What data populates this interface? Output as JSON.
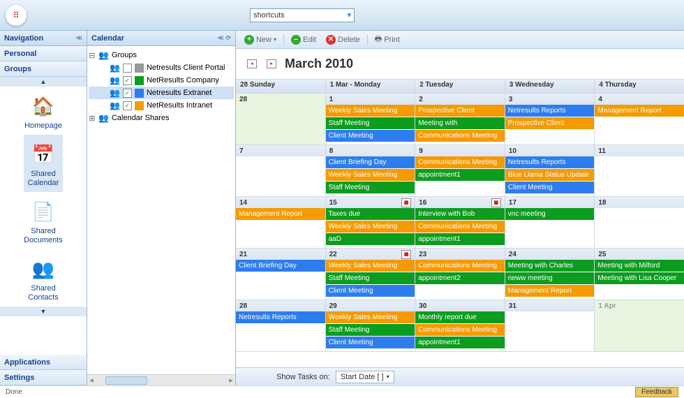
{
  "top": {
    "shortcuts": "shortcuts"
  },
  "nav": {
    "title": "Navigation",
    "personal": "Personal",
    "groups": "Groups",
    "applications": "Applications",
    "settings": "Settings",
    "items": [
      {
        "label": "Homepage"
      },
      {
        "label": "Shared Calendar"
      },
      {
        "label": "Shared Documents"
      },
      {
        "label": "Shared Contacts"
      }
    ]
  },
  "cal": {
    "title": "Calendar",
    "tree": {
      "root": "Groups",
      "shares": "Calendar Shares",
      "items": [
        {
          "label": "Netresults Client Portal",
          "checked": false,
          "color": "#999999"
        },
        {
          "label": "NetResults Company",
          "checked": true,
          "color": "#0c9d1f"
        },
        {
          "label": "Netresults Extranet",
          "checked": true,
          "color": "#2d7def"
        },
        {
          "label": "NetResults Intranet",
          "checked": true,
          "color": "#f59a00"
        }
      ]
    }
  },
  "toolbar": {
    "new": "New",
    "edit": "Edit",
    "delete": "Delete",
    "print": "Print"
  },
  "month": {
    "title": "March 2010"
  },
  "headers": [
    "28 Sunday",
    "1 Mar - Monday",
    "2 Tuesday",
    "3 Wednesday",
    "4 Thursday"
  ],
  "weeks": [
    {
      "days": [
        {
          "num": "28",
          "pale": true,
          "events": []
        },
        {
          "num": "1",
          "events": [
            {
              "t": "Weekly Sales Meeting",
              "c": "orange"
            },
            {
              "t": "Staff Meeting",
              "c": "green"
            },
            {
              "t": "Client Meeting",
              "c": "blue"
            }
          ]
        },
        {
          "num": "2",
          "events": [
            {
              "t": "Prospective Client",
              "c": "orange"
            },
            {
              "t": "Meeting with",
              "c": "green"
            },
            {
              "t": "Communications Meeting",
              "c": "orange"
            }
          ]
        },
        {
          "num": "3",
          "events": [
            {
              "t": "Netresults Reports",
              "c": "blue"
            },
            {
              "t": "Prospective Client",
              "c": "orange"
            }
          ]
        },
        {
          "num": "4",
          "events": [
            {
              "t": "Management Report",
              "c": "orange"
            }
          ]
        }
      ]
    },
    {
      "days": [
        {
          "num": "7",
          "events": []
        },
        {
          "num": "8",
          "events": [
            {
              "t": "Client Briefing Day",
              "c": "blue"
            },
            {
              "t": "Weekly Sales Meeting",
              "c": "orange"
            },
            {
              "t": "Staff Meeting",
              "c": "green"
            }
          ]
        },
        {
          "num": "9",
          "events": [
            {
              "t": "Communications Meeting",
              "c": "orange"
            },
            {
              "t": "appointment1",
              "c": "green"
            }
          ]
        },
        {
          "num": "10",
          "events": [
            {
              "t": "Netresults Reports",
              "c": "blue"
            },
            {
              "t": "Blue Llama Status Update",
              "c": "orange"
            },
            {
              "t": "Client Meeting",
              "c": "blue"
            }
          ]
        },
        {
          "num": "11",
          "events": []
        }
      ]
    },
    {
      "days": [
        {
          "num": "14",
          "events": [
            {
              "t": "Management Report",
              "c": "orange"
            }
          ]
        },
        {
          "num": "15",
          "flag": true,
          "events": [
            {
              "t": "Taxes due",
              "c": "green"
            },
            {
              "t": "Weekly Sales Meeting",
              "c": "orange"
            },
            {
              "t": "aaD",
              "c": "green"
            }
          ]
        },
        {
          "num": "16",
          "flag": true,
          "events": [
            {
              "t": "Interview with Bob",
              "c": "green"
            },
            {
              "t": "Communications Meeting",
              "c": "orange"
            },
            {
              "t": "appointment1",
              "c": "green"
            }
          ]
        },
        {
          "num": "17",
          "events": [
            {
              "t": "vnc meeting",
              "c": "green"
            }
          ]
        },
        {
          "num": "18",
          "events": []
        }
      ]
    },
    {
      "days": [
        {
          "num": "21",
          "events": [
            {
              "t": "Client Briefing Day",
              "c": "blue"
            }
          ]
        },
        {
          "num": "22",
          "flag": true,
          "events": [
            {
              "t": "Weekly Sales Meeting",
              "c": "orange"
            },
            {
              "t": "Staff Meeting",
              "c": "green"
            },
            {
              "t": "Client Meeting",
              "c": "blue"
            }
          ]
        },
        {
          "num": "23",
          "events": [
            {
              "t": "Communications Meeting",
              "c": "orange"
            },
            {
              "t": "appointment2",
              "c": "green"
            }
          ]
        },
        {
          "num": "24",
          "events": [
            {
              "t": "Meeting with Charles",
              "c": "green"
            },
            {
              "t": "neww meeting",
              "c": "green"
            },
            {
              "t": "Management Report",
              "c": "orange"
            }
          ]
        },
        {
          "num": "25",
          "events": [
            {
              "t": "Meeting with Milford",
              "c": "green"
            },
            {
              "t": "Meeting with Lisa Cooper",
              "c": "green"
            }
          ]
        }
      ]
    },
    {
      "days": [
        {
          "num": "28",
          "events": [
            {
              "t": "Netresults Reports",
              "c": "blue"
            }
          ]
        },
        {
          "num": "29",
          "events": [
            {
              "t": "Weekly Sales Meeting",
              "c": "orange"
            },
            {
              "t": "Staff Meeting",
              "c": "green"
            },
            {
              "t": "Client Meeting",
              "c": "blue"
            }
          ]
        },
        {
          "num": "30",
          "events": [
            {
              "t": "Monthly report due",
              "c": "green"
            },
            {
              "t": "Communications Meeting",
              "c": "orange"
            },
            {
              "t": "appointment1",
              "c": "green"
            }
          ]
        },
        {
          "num": "31",
          "events": []
        },
        {
          "num": "1 Apr",
          "pale": true,
          "out": true,
          "events": []
        }
      ]
    }
  ],
  "bottom": {
    "tasks_label": "Show Tasks on:",
    "btn": "Start Date [ ]"
  },
  "status": {
    "done": "Done",
    "feedback": "Feedback"
  }
}
